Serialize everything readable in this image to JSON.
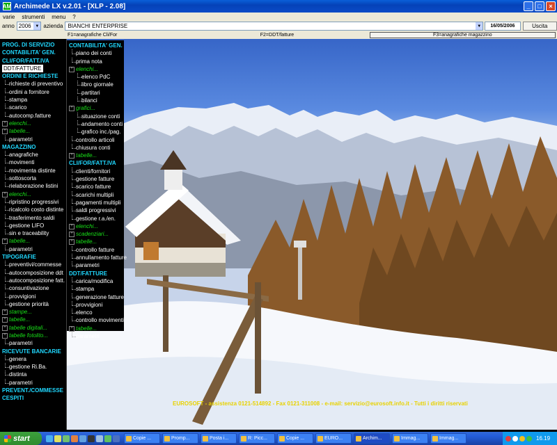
{
  "window": {
    "title": "Archimede LX v.2.01 - [XLP - 2.08]",
    "app_icon": "AM"
  },
  "menu": [
    "varie",
    "strumenti",
    "menu",
    "?"
  ],
  "toolbar": {
    "anno_label": "anno",
    "anno_value": "2006",
    "azienda_label": "azienda",
    "azienda_value": "BIANCHI ENTERPRISE",
    "date": "16/05/2006",
    "uscita": "Uscita"
  },
  "functions": [
    "F1=anagrafiche Cli/For",
    "F2=DDT/fatture",
    "F3=anagrafiche magazzino"
  ],
  "left_tree": [
    {
      "t": "hdr",
      "label": "PROG. DI SERVIZIO"
    },
    {
      "t": "hdr",
      "label": "CONTABILITA' GEN."
    },
    {
      "t": "hdr",
      "label": "CLI/FOR/FATT.IVA"
    },
    {
      "t": "sel",
      "label": "DDT/FATTURE"
    },
    {
      "t": "hdr",
      "label": "ORDINI E RICHIESTE"
    },
    {
      "t": "item",
      "label": "richieste di preventivo"
    },
    {
      "t": "item",
      "label": "ordini a fornitore"
    },
    {
      "t": "item",
      "label": "stampa"
    },
    {
      "t": "item",
      "label": "scarico"
    },
    {
      "t": "item",
      "label": "autocomp.fatture"
    },
    {
      "t": "grp",
      "label": "elenchi..."
    },
    {
      "t": "grp",
      "label": "tabelle..."
    },
    {
      "t": "item",
      "label": "parametri"
    },
    {
      "t": "hdr",
      "label": "MAGAZZINO"
    },
    {
      "t": "item",
      "label": "anagrafiche"
    },
    {
      "t": "item",
      "label": "movimenti"
    },
    {
      "t": "item",
      "label": "movimenta distinte"
    },
    {
      "t": "item",
      "label": "sottoscorta"
    },
    {
      "t": "item",
      "label": "rielaborazione listini"
    },
    {
      "t": "grp",
      "label": "elenchi..."
    },
    {
      "t": "item",
      "label": "ripristino progressivi"
    },
    {
      "t": "item",
      "label": "ricalcolo costo distinte"
    },
    {
      "t": "item",
      "label": "trasferimento saldi"
    },
    {
      "t": "item",
      "label": "gestione LIFO"
    },
    {
      "t": "item",
      "label": "sin e traceability"
    },
    {
      "t": "grp",
      "label": "tabelle..."
    },
    {
      "t": "item",
      "label": "parametri"
    },
    {
      "t": "hdr",
      "label": "TIPOGRAFIE"
    },
    {
      "t": "item",
      "label": "preventivi/commesse"
    },
    {
      "t": "item",
      "label": "autocomposizione ddt"
    },
    {
      "t": "item",
      "label": "autocomposizione fatt."
    },
    {
      "t": "item",
      "label": "consuntivazione"
    },
    {
      "t": "item",
      "label": "provvigioni"
    },
    {
      "t": "item",
      "label": "gestione priorità"
    },
    {
      "t": "grp",
      "label": "stampe..."
    },
    {
      "t": "grp",
      "label": "tabelle..."
    },
    {
      "t": "grp",
      "label": "tabelle digitali..."
    },
    {
      "t": "grp",
      "label": "tabelle fotolito..."
    },
    {
      "t": "item",
      "label": "parametri"
    },
    {
      "t": "hdr",
      "label": "RICEVUTE BANCARIE"
    },
    {
      "t": "item",
      "label": "genera"
    },
    {
      "t": "item",
      "label": "gestione Ri.Ba."
    },
    {
      "t": "item",
      "label": "distinta"
    },
    {
      "t": "item",
      "label": "parametri"
    },
    {
      "t": "hdr",
      "label": "PREVENT./COMMESSE"
    },
    {
      "t": "hdr",
      "label": "CESPITI"
    }
  ],
  "mid_tree": [
    {
      "t": "hdr",
      "label": "CONTABILITA' GEN."
    },
    {
      "t": "item",
      "label": "piano dei conti"
    },
    {
      "t": "item",
      "label": "prima nota"
    },
    {
      "t": "grp",
      "label": "elenchi..."
    },
    {
      "t": "sub",
      "label": "elenco PdC"
    },
    {
      "t": "sub",
      "label": "libro giornale"
    },
    {
      "t": "sub",
      "label": "partitari"
    },
    {
      "t": "sub",
      "label": "bilanci"
    },
    {
      "t": "grp",
      "label": "grafici..."
    },
    {
      "t": "sub",
      "label": "situazione conti"
    },
    {
      "t": "sub",
      "label": "andamento conti"
    },
    {
      "t": "sub",
      "label": "grafico inc./pag."
    },
    {
      "t": "item",
      "label": "controllo articoli"
    },
    {
      "t": "item",
      "label": "chiusura conti"
    },
    {
      "t": "grp",
      "label": "tabelle..."
    },
    {
      "t": "hdr",
      "label": "CLI/FOR/FATT.IVA"
    },
    {
      "t": "item",
      "label": "clienti/fornitori"
    },
    {
      "t": "item",
      "label": "gestione fatture"
    },
    {
      "t": "item",
      "label": "scarico fatture"
    },
    {
      "t": "item",
      "label": "scarichi multipli"
    },
    {
      "t": "item",
      "label": "pagamenti multipli"
    },
    {
      "t": "item",
      "label": "saldi progressivi"
    },
    {
      "t": "item",
      "label": "gestione r.a./en."
    },
    {
      "t": "grp",
      "label": "elenchi..."
    },
    {
      "t": "grp",
      "label": "scadenziari..."
    },
    {
      "t": "grp",
      "label": "tabelle..."
    },
    {
      "t": "item",
      "label": "controllo fatture"
    },
    {
      "t": "item",
      "label": "annullamento fatture"
    },
    {
      "t": "item",
      "label": "parametri"
    },
    {
      "t": "hdr",
      "label": "DDT/FATTURE"
    },
    {
      "t": "item",
      "label": "carica/modifica"
    },
    {
      "t": "item",
      "label": "stampa"
    },
    {
      "t": "item",
      "label": "generazione fatture"
    },
    {
      "t": "item",
      "label": "provvigioni"
    },
    {
      "t": "item",
      "label": "elenco"
    },
    {
      "t": "item",
      "label": "controllo movimenti"
    },
    {
      "t": "grp",
      "label": "tabelle..."
    },
    {
      "t": "item",
      "label": "parametri"
    }
  ],
  "footer": "EUROSOFT - assistenza 0121-514892 - Fax 0121-311008 - e-mail: servizio@eurosoft.info.it - Tutti i diritti riservati",
  "taskbar": {
    "start": "start",
    "tasks": [
      "Copie ...",
      "Promp...",
      "Posta i...",
      "R: Picc...",
      "Copie ...",
      "EURO...",
      "Archim...",
      "Immag...",
      "Immag..."
    ],
    "active_index": 6,
    "clock": "16.19"
  }
}
